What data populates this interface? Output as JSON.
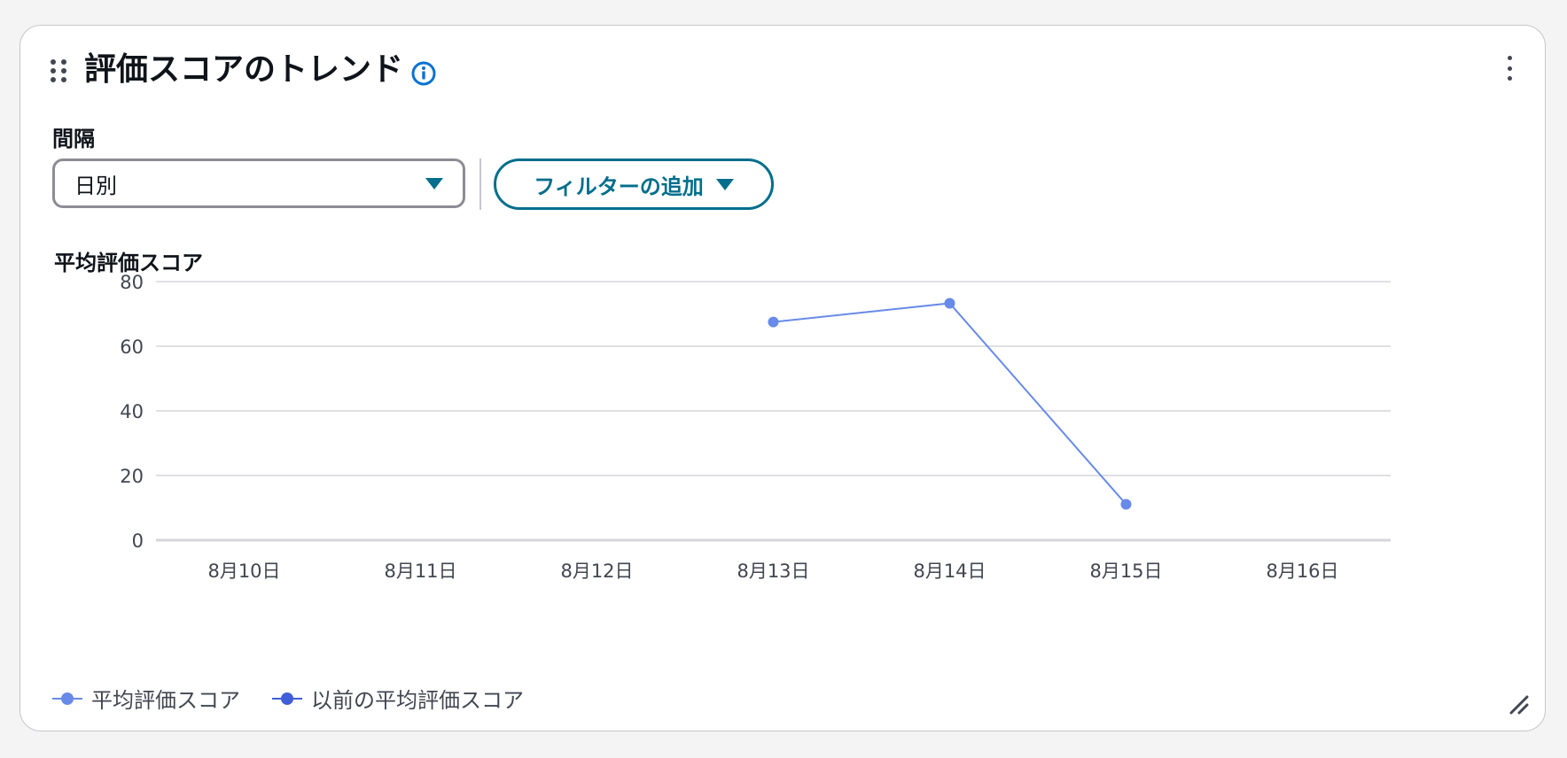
{
  "widget": {
    "title": "評価スコアのトレンド",
    "interval_label": "間隔",
    "interval_value": "日別",
    "filter_button_label": "フィルターの追加"
  },
  "icons": {
    "drag": "drag-handle-icon",
    "info": "info-icon",
    "menu": "kebab-menu-icon",
    "caret": "caret-down-icon",
    "resize": "resize-icon"
  },
  "colors": {
    "accent": "#006e8c",
    "info": "#0972d3",
    "series_current": "#688ae8",
    "series_previous": "#3f5ed7",
    "gridline": "#e0e0e4"
  },
  "chart_data": {
    "type": "line",
    "title": "平均評価スコア",
    "xlabel": "",
    "ylabel": "",
    "categories": [
      "8月10日",
      "8月11日",
      "8月12日",
      "8月13日",
      "8月14日",
      "8月15日",
      "8月16日"
    ],
    "ylim": [
      0,
      80
    ],
    "yticks": [
      0,
      20,
      40,
      60,
      80
    ],
    "grid": true,
    "legend_position": "bottom-left",
    "series": [
      {
        "name": "平均評価スコア",
        "values": [
          null,
          null,
          null,
          67.5,
          73.3,
          11.1,
          null
        ],
        "color": "#688ae8"
      },
      {
        "name": "以前の平均評価スコア",
        "values": [
          null,
          null,
          null,
          null,
          null,
          null,
          null
        ],
        "color": "#3f5ed7"
      }
    ]
  }
}
